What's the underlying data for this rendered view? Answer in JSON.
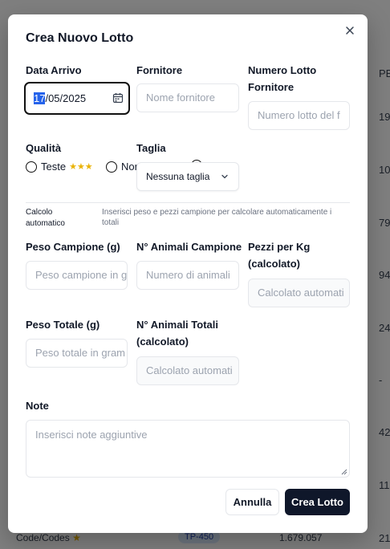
{
  "background": {
    "right_col_header": "PE",
    "right_col_values": [
      "19",
      "10",
      "79",
      "94",
      "24",
      "-",
      "42",
      "11"
    ],
    "footer_row": {
      "name": "Code/Codes",
      "star": "★",
      "badge": "TP-450",
      "value": "1.679.057",
      "right": "21"
    }
  },
  "modal": {
    "title": "Crea Nuovo Lotto",
    "close_icon": "close-icon",
    "data_arrivo": {
      "label": "Data Arrivo",
      "day": "17",
      "rest": "/05/2025"
    },
    "fornitore": {
      "label": "Fornitore",
      "placeholder": "Nome fornitore"
    },
    "numero_lotto": {
      "label_line1": "Numero Lotto",
      "label_line2": "Fornitore",
      "placeholder": "Numero lotto del f"
    },
    "qualita": {
      "label": "Qualità",
      "options": [
        {
          "label": "Teste",
          "stars": "★★★"
        },
        {
          "label": "Nor",
          "stars": ""
        }
      ]
    },
    "taglia": {
      "label": "Taglia",
      "selected": "Nessuna taglia"
    },
    "calcolo": {
      "title": "Calcolo automatico",
      "description": "Inserisci peso e pezzi campione per calcolare automaticamente i totali"
    },
    "peso_campione": {
      "label": "Peso Campione (g)",
      "placeholder": "Peso campione in g"
    },
    "animali_campione": {
      "label": "N° Animali Campione",
      "placeholder": "Numero di animali"
    },
    "pezzi_kg": {
      "label_line1": "Pezzi per Kg",
      "label_line2": "(calcolato)",
      "placeholder": "Calcolato automati"
    },
    "peso_totale": {
      "label": "Peso Totale (g)",
      "placeholder": "Peso totale in gram"
    },
    "animali_totali": {
      "label_line1": "N° Animali Totali",
      "label_line2": "(calcolato)",
      "placeholder": "Calcolato automati"
    },
    "note": {
      "label": "Note",
      "placeholder": "Inserisci note aggiuntive"
    },
    "buttons": {
      "cancel": "Annulla",
      "create": "Crea Lotto"
    }
  }
}
